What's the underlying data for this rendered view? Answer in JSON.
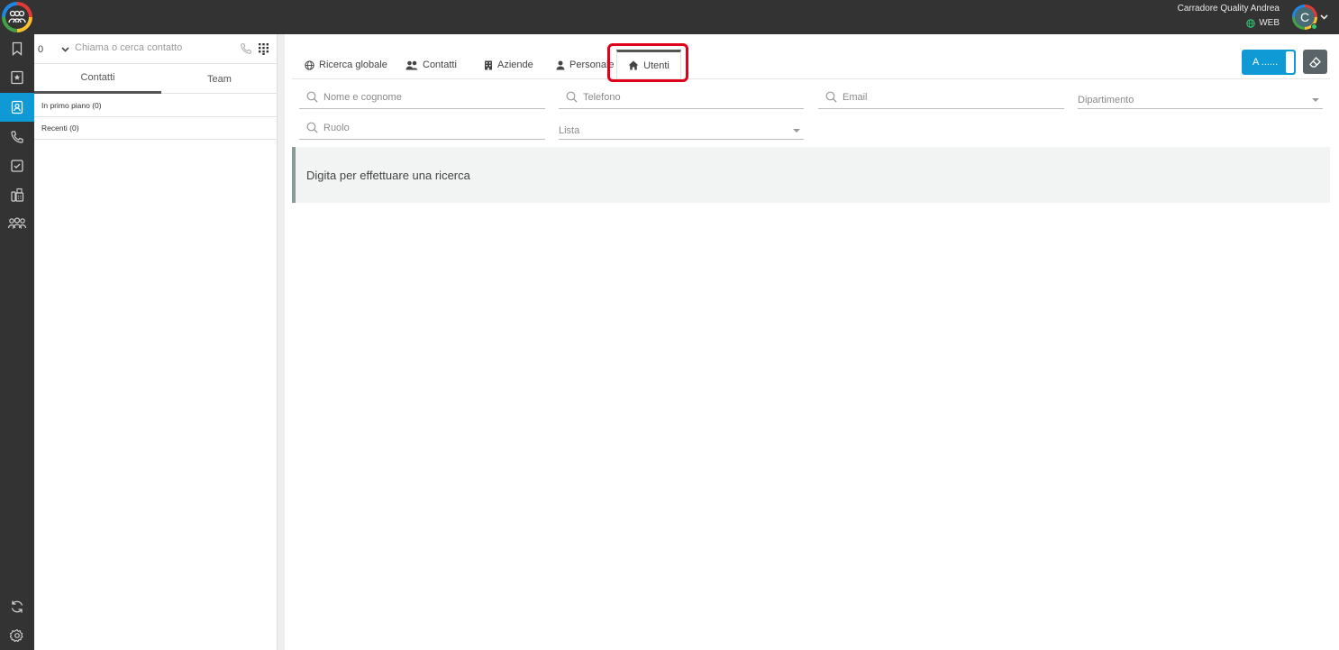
{
  "user": {
    "name": "Carradore Quality Andrea",
    "status": "WEB",
    "initial": "C"
  },
  "rail": {
    "items": [
      {
        "icon": "bookmark-icon"
      },
      {
        "icon": "star-book-icon"
      },
      {
        "icon": "contacts-icon",
        "active": true
      },
      {
        "icon": "phone-icon"
      },
      {
        "icon": "checklist-icon"
      },
      {
        "icon": "fax-icon"
      },
      {
        "icon": "team-icon"
      }
    ],
    "bottom": [
      {
        "icon": "sync-icon"
      },
      {
        "icon": "settings-icon"
      }
    ]
  },
  "contacts_panel": {
    "count": "0",
    "search_placeholder": "Chiama o cerca contatto",
    "tabs": [
      {
        "label": "Contatti",
        "active": true
      },
      {
        "label": "Team"
      }
    ],
    "groups": [
      {
        "label": "In primo piano (0)"
      },
      {
        "label": "Recenti (0)"
      }
    ]
  },
  "main": {
    "tabs": [
      {
        "label": "Ricerca globale",
        "icon": "globe-icon"
      },
      {
        "label": "Contatti",
        "icon": "users-icon"
      },
      {
        "label": "Aziende",
        "icon": "building-icon"
      },
      {
        "label": "Personale",
        "icon": "person-icon"
      },
      {
        "label": "Utenti",
        "icon": "home-icon",
        "active": true
      }
    ],
    "toggle_button_label": "A ......",
    "fields": {
      "name_placeholder": "Nome e cognome",
      "phone_placeholder": "Telefono",
      "email_placeholder": "Email",
      "department_placeholder": "Dipartimento",
      "role_placeholder": "Ruolo",
      "list_placeholder": "Lista"
    },
    "info_message": "Digita per effettuare una ricerca"
  },
  "colors": {
    "accent": "#0f9ad6",
    "highlight": "#e0001b",
    "dark": "#333333"
  }
}
